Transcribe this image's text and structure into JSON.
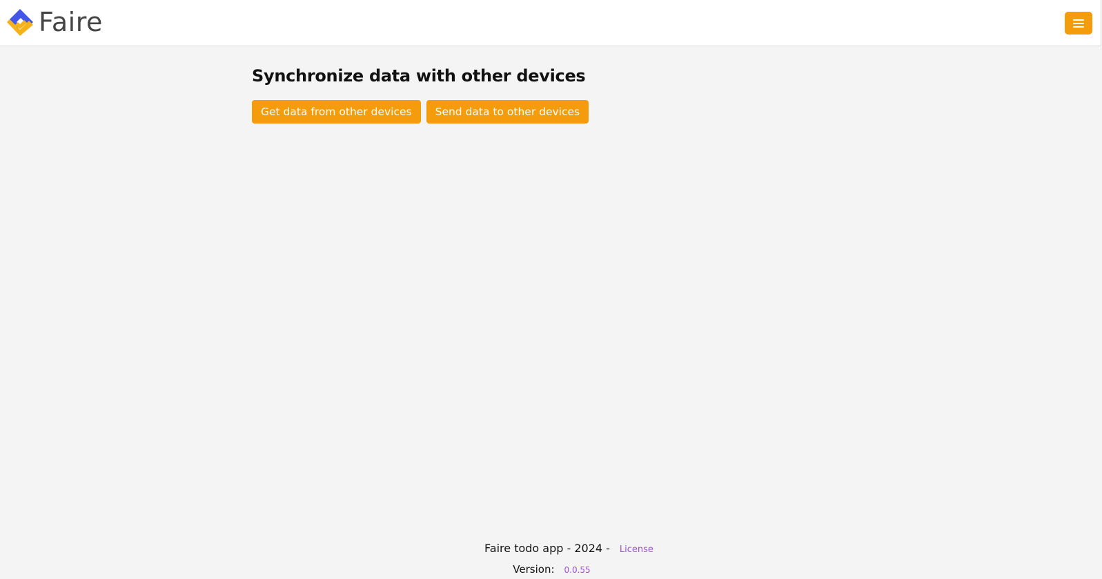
{
  "header": {
    "logo_text": "Faire",
    "menu_icon": "hamburger-menu-icon",
    "accent_color": "#f59c0d"
  },
  "main": {
    "title": "Synchronize data with other devices",
    "buttons": {
      "get_data": "Get data from other devices",
      "send_data": "Send data to other devices"
    }
  },
  "footer": {
    "app_text": "Faire todo app - 2024 -",
    "license_link": "License",
    "version_label": "Version:",
    "version_value": "0.0.55",
    "link_color": "#9b4fd6"
  }
}
